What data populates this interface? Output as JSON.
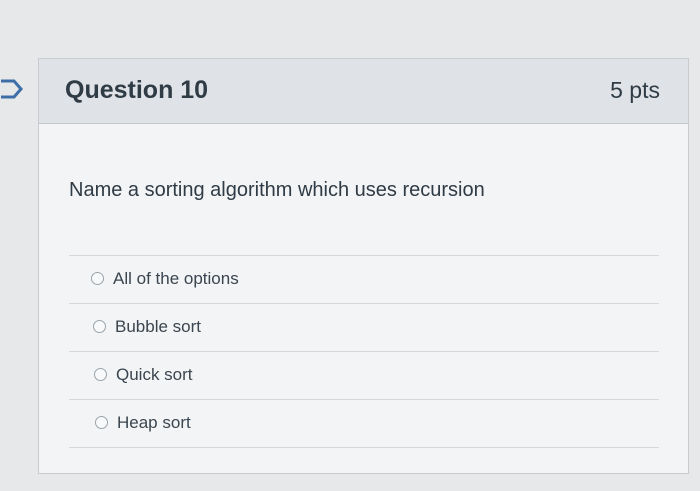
{
  "question": {
    "title": "Question 10",
    "points": "5 pts",
    "text": "Name a sorting algorithm which uses recursion"
  },
  "answers": [
    {
      "label": "All of the options"
    },
    {
      "label": "Bubble sort"
    },
    {
      "label": "Quick sort"
    },
    {
      "label": "Heap sort"
    }
  ],
  "icons": {
    "flag": "bookmark-flag-icon",
    "radio": "radio-button-icon"
  },
  "colors": {
    "header_bg": "#dfe2e6",
    "card_bg": "#f3f4f6",
    "text": "#2f3b45",
    "flag_stroke": "#3d6ea8"
  }
}
